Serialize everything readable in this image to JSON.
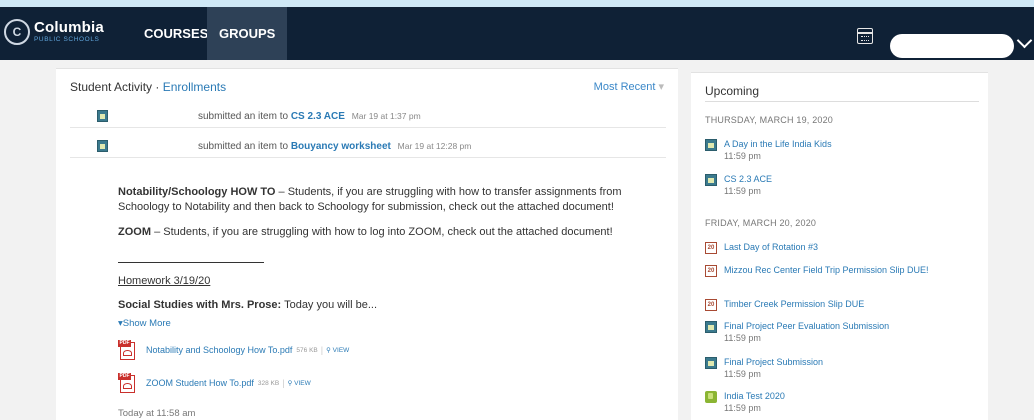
{
  "navbar": {
    "logo_name": "Columbia",
    "logo_sub": "PUBLIC SCHOOLS",
    "tabs": [
      "COURSES",
      "GROUPS"
    ],
    "active_tab": "GROUPS",
    "user_name": "",
    "colors": {
      "bar": "#0f2136",
      "active_tab": "#2e4157",
      "link": "#2a7ab5"
    }
  },
  "activity": {
    "title": "Student Activity",
    "link": "Enrollments",
    "sort": "Most Recent",
    "rows": [
      {
        "action": "submitted an item to",
        "item": "CS 2.3 ACE",
        "time": "Mar 19 at 1:37 pm"
      },
      {
        "action": "submitted an item to",
        "item": "Bouyancy worksheet",
        "time": "Mar 19 at 12:28 pm"
      }
    ]
  },
  "post": {
    "notability_title": "Notability/Schoology HOW TO",
    "notability_text": "– Students, if you are struggling with how to transfer assignments from Schoology to Notability and then back to Schoology for submission, check out the attached document!",
    "zoom_title": "ZOOM",
    "zoom_text": "– Students, if you are struggling with how to log into ZOOM, check out the attached document!",
    "homework": "Homework 3/19/20",
    "ss_title": "Social Studies with Mrs. Prose:",
    "ss_text": "Today you will be...",
    "show_more": "Show More",
    "attachments": [
      {
        "name": "Notability and Schoology How To.pdf",
        "size": "576 KB",
        "view": "VIEW"
      },
      {
        "name": "ZOOM Student How To.pdf",
        "size": "328 KB",
        "view": "VIEW"
      }
    ],
    "posted": "Today at 11:58 am"
  },
  "upcoming": {
    "title": "Upcoming",
    "days": [
      {
        "label": "THURSDAY, MARCH 19, 2020",
        "events": [
          {
            "icon": "assignment-icon",
            "title": "A Day in the Life India Kids",
            "time": "11:59 pm"
          },
          {
            "icon": "assignment-icon",
            "title": "CS 2.3 ACE",
            "time": "11:59 pm"
          }
        ]
      },
      {
        "label": "FRIDAY, MARCH 20, 2020",
        "events": [
          {
            "icon": "calendar-event-icon",
            "title": "Last Day of Rotation #3",
            "time": ""
          },
          {
            "icon": "calendar-event-icon",
            "title": "Mizzou Rec Center Field Trip Permission Slip DUE!",
            "time": ""
          },
          {
            "icon": "calendar-event-icon",
            "title": "Timber Creek Permission Slip DUE",
            "time": ""
          },
          {
            "icon": "assignment-icon",
            "title": "Final Project Peer Evaluation Submission",
            "time": "11:59 pm"
          },
          {
            "icon": "assignment-icon",
            "title": "Final Project Submission",
            "time": "11:59 pm"
          },
          {
            "icon": "test-icon",
            "title": "India Test 2020",
            "time": "11:59 pm"
          }
        ]
      }
    ],
    "calendar_icon_text": "20"
  }
}
